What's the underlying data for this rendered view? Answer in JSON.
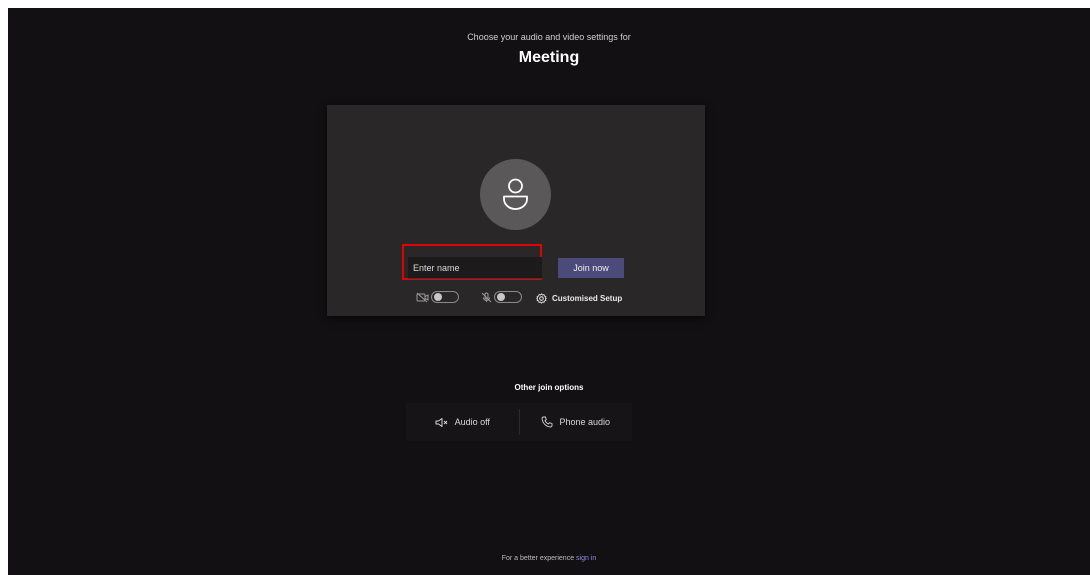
{
  "header": {
    "prompt": "Choose your audio and video settings for",
    "meeting_title": "Meeting"
  },
  "prejoin": {
    "name_input": {
      "placeholder": "Enter name",
      "value": ""
    },
    "join_button": "Join now",
    "camera_toggle": {
      "icon": "camera-off-icon",
      "state": "off"
    },
    "mic_toggle": {
      "icon": "mic-off-icon",
      "state": "off"
    },
    "customised_setup": "Customised Setup"
  },
  "other_join": {
    "label": "Other join options",
    "options": [
      {
        "icon": "speaker-off-icon",
        "label": "Audio off"
      },
      {
        "icon": "phone-icon",
        "label": "Phone audio"
      }
    ]
  },
  "footer": {
    "text": "For a better experience",
    "link": "sign in"
  },
  "colors": {
    "background": "#121012",
    "card": "#2a2728",
    "join_button": "#4b4a7a",
    "highlight": "#e00000",
    "link": "#8f8fe8"
  }
}
